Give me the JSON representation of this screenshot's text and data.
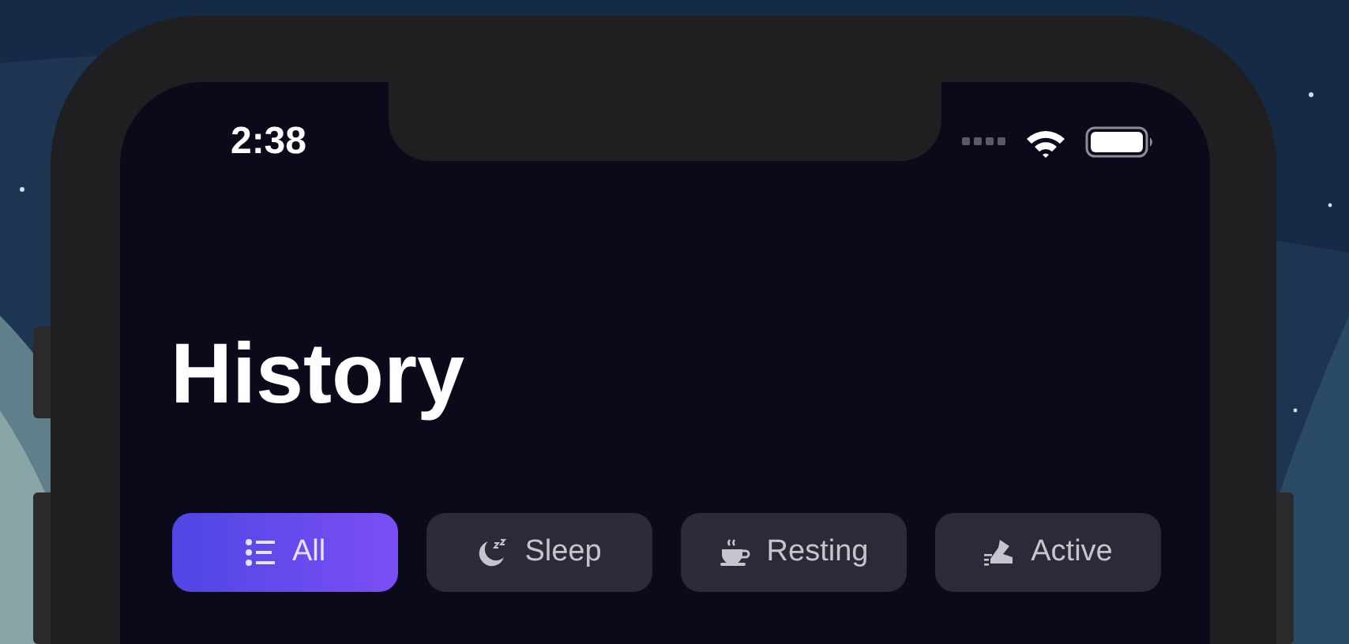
{
  "status_bar": {
    "time": "2:38"
  },
  "title": "History",
  "filters": [
    {
      "label": "All",
      "kind": "all",
      "selected": true
    },
    {
      "label": "Sleep",
      "kind": "sleep",
      "selected": false
    },
    {
      "label": "Resting",
      "kind": "resting",
      "selected": false
    },
    {
      "label": "Active",
      "kind": "active",
      "selected": false
    }
  ]
}
